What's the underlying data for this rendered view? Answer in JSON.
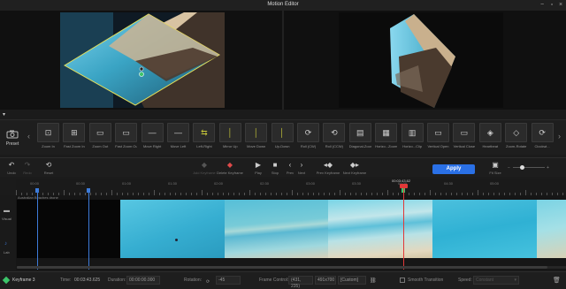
{
  "window": {
    "title": "Motion Editor"
  },
  "presets": {
    "label": "Preset",
    "items": [
      "Zoom In",
      "Fast Zoom In",
      "Zoom Out",
      "Fast Zoom Out",
      "Move Right",
      "Move Left",
      "Left-Right",
      "Mirror Up",
      "Move Down",
      "Up-Down",
      "Roll (CW)",
      "Roll (CCW)",
      "Diagonal-Zoom",
      "Horizo...Zoom",
      "Horizo...Clip",
      "Vertical Open",
      "Vertical Close",
      "Heartbeat",
      "Zoom-Rotate",
      "Clockwi..."
    ]
  },
  "toolbar": {
    "undo": "Undo",
    "redo": "Redo",
    "reset": "Reset",
    "add_keyframe": "Add Keyframe",
    "delete_keyframe": "Delete Keyframe",
    "play": "Play",
    "stop": "Stop",
    "prev": "Prev",
    "next": "Next",
    "prev_keyframe": "Prev Keyframe",
    "next_keyframe": "Next Keyframe",
    "apply": "Apply",
    "fit_size": "Fit Size"
  },
  "timeline": {
    "playhead_time": "00:03:43.62",
    "track_title": "Australian Beaches drone",
    "ruler_labels": [
      "00:00",
      "00:30",
      "01:00",
      "01:30",
      "02:00",
      "02:30",
      "03:00",
      "03:30",
      "04:00",
      "04:30",
      "05:00"
    ],
    "side_visual": "Visual",
    "side_lab": "Lab"
  },
  "status": {
    "keyframe": "Keyframe 3",
    "time_label": "Time:",
    "time_value": "00:03:43.625",
    "duration_label": "Duration:",
    "duration_value": "00:00:00.000",
    "rotation_label": "Rotation:",
    "rotation_value": "-45",
    "frame_label": "Frame Control:",
    "frame_value": "(431, 235)",
    "size_value": "491x700",
    "mode_value": "[Custom]",
    "smooth_label": "Smooth Transition",
    "speed_label": "Speed:",
    "speed_value": "Constant"
  },
  "colors": {
    "accent": "#2a70e6",
    "keyframe": "#3d7bd9",
    "playhead": "#e03838",
    "selection": "#e6e05a"
  }
}
